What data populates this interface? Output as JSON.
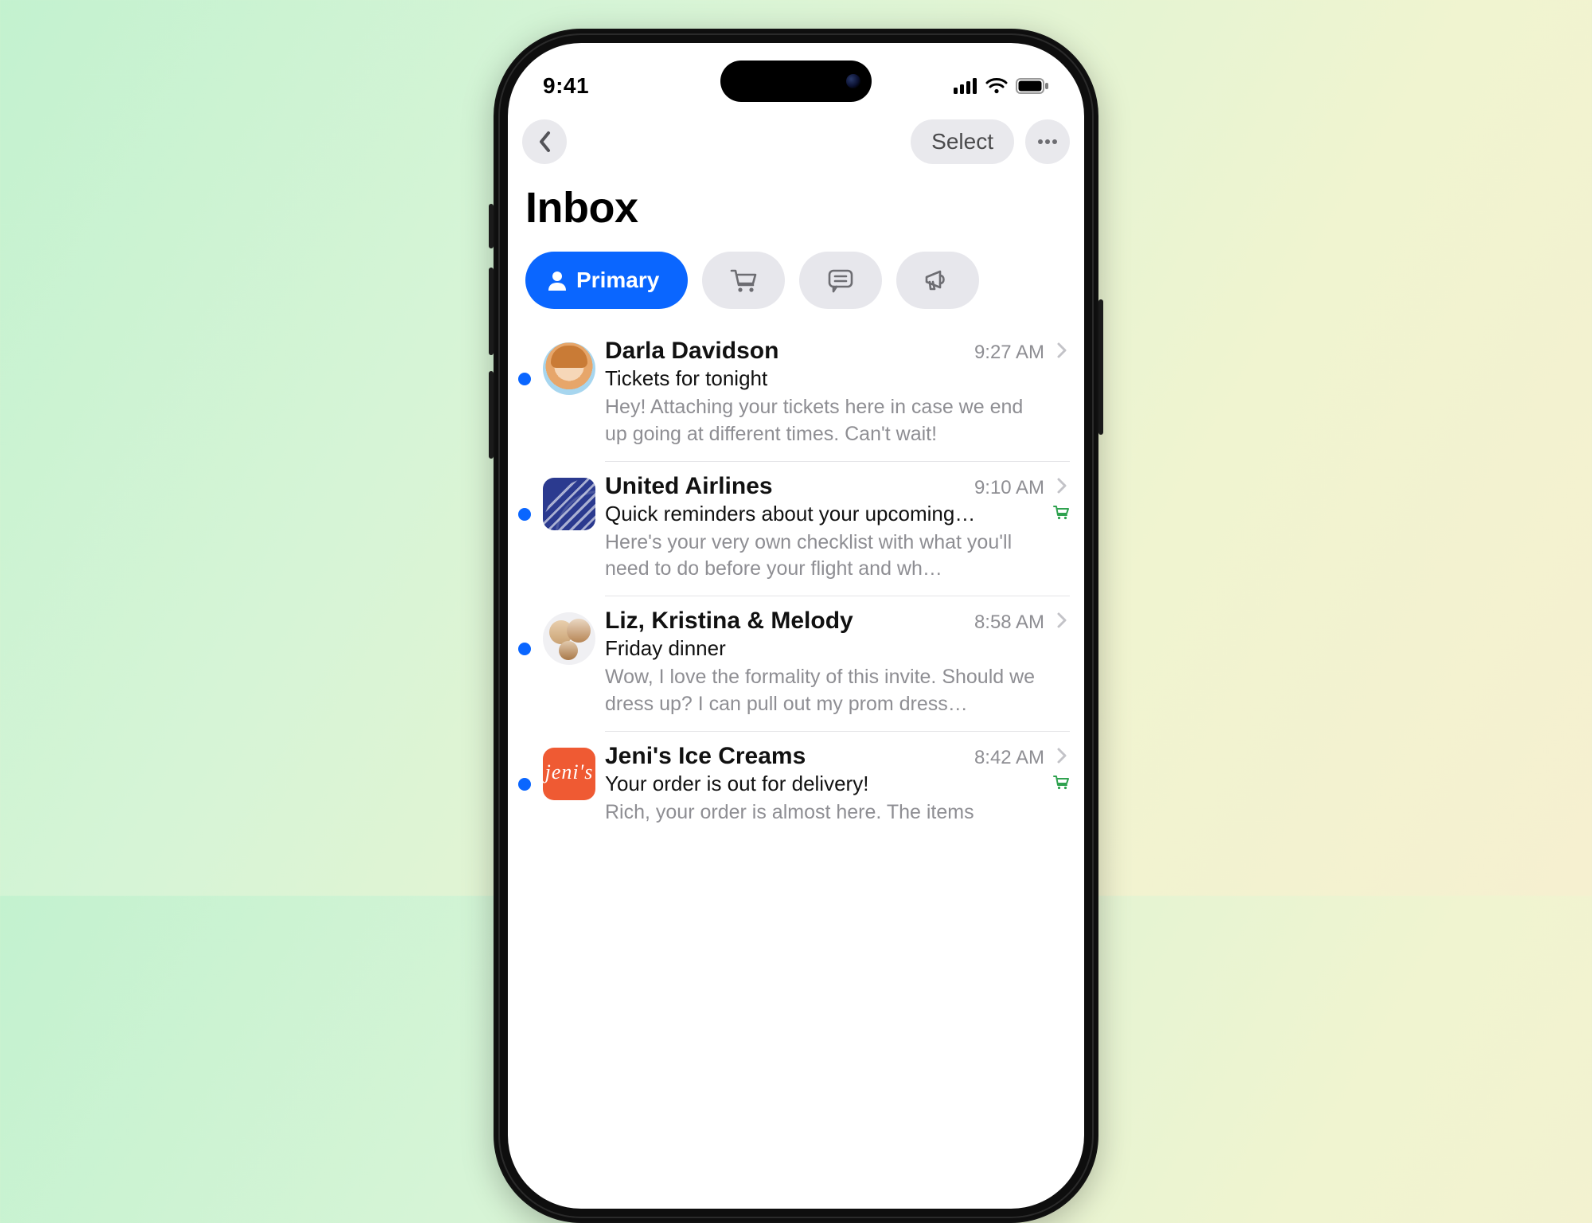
{
  "status": {
    "time": "9:41"
  },
  "nav": {
    "select_label": "Select"
  },
  "page_title": "Inbox",
  "categories": {
    "primary_label": "Primary"
  },
  "emails": [
    {
      "sender": "Darla Davidson",
      "time": "9:27 AM",
      "subject": "Tickets for tonight",
      "preview": "Hey! Attaching your tickets here in case we end up going at different times. Can't wait!",
      "unread": true,
      "avatar": "darla",
      "tag": null
    },
    {
      "sender": "United Airlines",
      "time": "9:10 AM",
      "subject": "Quick reminders about your upcoming…",
      "preview": "Here's your very own checklist with what you'll need to do before your flight and wh…",
      "unread": true,
      "avatar": "united",
      "tag": "cart"
    },
    {
      "sender": "Liz, Kristina & Melody",
      "time": "8:58 AM",
      "subject": "Friday dinner",
      "preview": "Wow, I love the formality of this invite. Should we dress up? I can pull out my prom dress…",
      "unread": true,
      "avatar": "group",
      "tag": null
    },
    {
      "sender": "Jeni's Ice Creams",
      "time": "8:42 AM",
      "subject": "Your order is out for delivery!",
      "preview": "Rich, your order is almost here. The items",
      "unread": true,
      "avatar": "jenis",
      "tag": "cart"
    }
  ]
}
